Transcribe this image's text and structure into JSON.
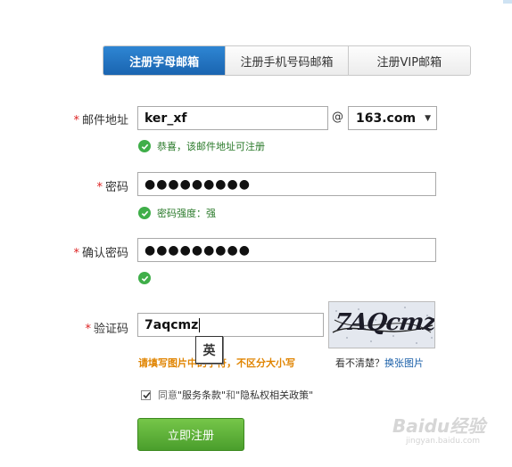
{
  "tabs": [
    {
      "label": "注册字母邮箱",
      "active": true
    },
    {
      "label": "注册手机号码邮箱",
      "active": false
    },
    {
      "label": "注册VIP邮箱",
      "active": false
    }
  ],
  "email": {
    "required_mark": "*",
    "label": "邮件地址",
    "value": "ker_xf",
    "at": "@",
    "domain": "163.com",
    "ok_message": "恭喜，该邮件地址可注册"
  },
  "password": {
    "required_mark": "*",
    "label": "密码",
    "value": "●●●●●●●●●",
    "ok_message": "密码强度：强"
  },
  "confirm_password": {
    "required_mark": "*",
    "label": "确认密码",
    "value": "●●●●●●●●●"
  },
  "captcha": {
    "required_mark": "*",
    "label": "验证码",
    "value": "7aqcmz",
    "image_text": "7AQcmz",
    "ime_indicator": "英",
    "hint": "请填写图片中的字符，不区分大小写",
    "refresh_prefix": "看不清楚？",
    "refresh_link": "换张图片"
  },
  "agreement": {
    "checked": true,
    "prefix": "同意",
    "terms": "\"服务条款\"",
    "and": "和",
    "privacy": "\"隐私权相关政策\""
  },
  "submit_label": "立即注册",
  "watermark": {
    "main": "Baidu经验",
    "sub": "jingyan.baidu.com"
  },
  "colors": {
    "tab_active": "#1a64b0",
    "success": "#3fae49",
    "hint": "#e08400",
    "submit": "#4a9e2c",
    "required": "#dd2222"
  }
}
